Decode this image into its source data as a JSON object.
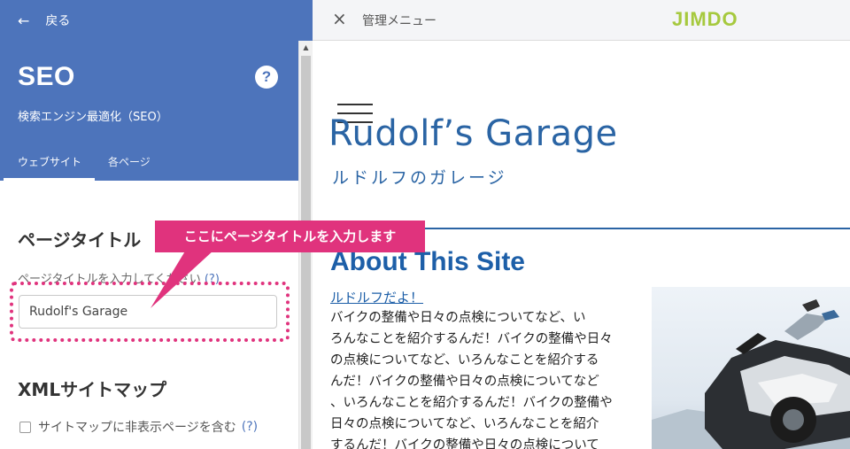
{
  "left_panel": {
    "back_label": "戻る",
    "title": "SEO",
    "help_symbol": "?",
    "subtitle": "検索エンジン最適化（SEO）",
    "tabs": [
      {
        "label": "ウェブサイト",
        "active": true
      },
      {
        "label": "各ページ",
        "active": false
      }
    ],
    "page_title_section": {
      "heading": "ページタイトル",
      "label": "ページタイトルを入力してください",
      "help_link": "(?)",
      "input_value": "Rudolf's Garage"
    },
    "sitemap_section": {
      "heading": "XMLサイトマップ",
      "checkbox_label": "サイトマップに非表示ページを含む",
      "checkbox_checked": false,
      "help_link": "(?)"
    }
  },
  "callout": {
    "text": "ここにページタイトルを入力します"
  },
  "topbar": {
    "close_label": "×",
    "menu_label": "管理メニュー",
    "logo_text": "JIMDO"
  },
  "site": {
    "title": "Rudolf’s Garage",
    "subtitle": "ルドルフのガレージ",
    "section_heading": "About This Site",
    "link_text": "ルドルフだよ！",
    "body_lines": [
      "バイクの整備や日々の点検についてなど、い",
      "ろんなことを紹介するんだ！バイクの整備や日々",
      "の点検についてなど、いろんなことを紹介する",
      "んだ！バイクの整備や日々の点検についてなど",
      "、いろんなことを紹介するんだ！バイクの整備や",
      "日々の点検についてなど、いろんなことを紹介",
      "するんだ！バイクの整備や日々の点検について"
    ]
  },
  "colors": {
    "panel_blue": "#4d74bb",
    "callout_pink": "#e0337d",
    "site_blue": "#2a64a4"
  }
}
